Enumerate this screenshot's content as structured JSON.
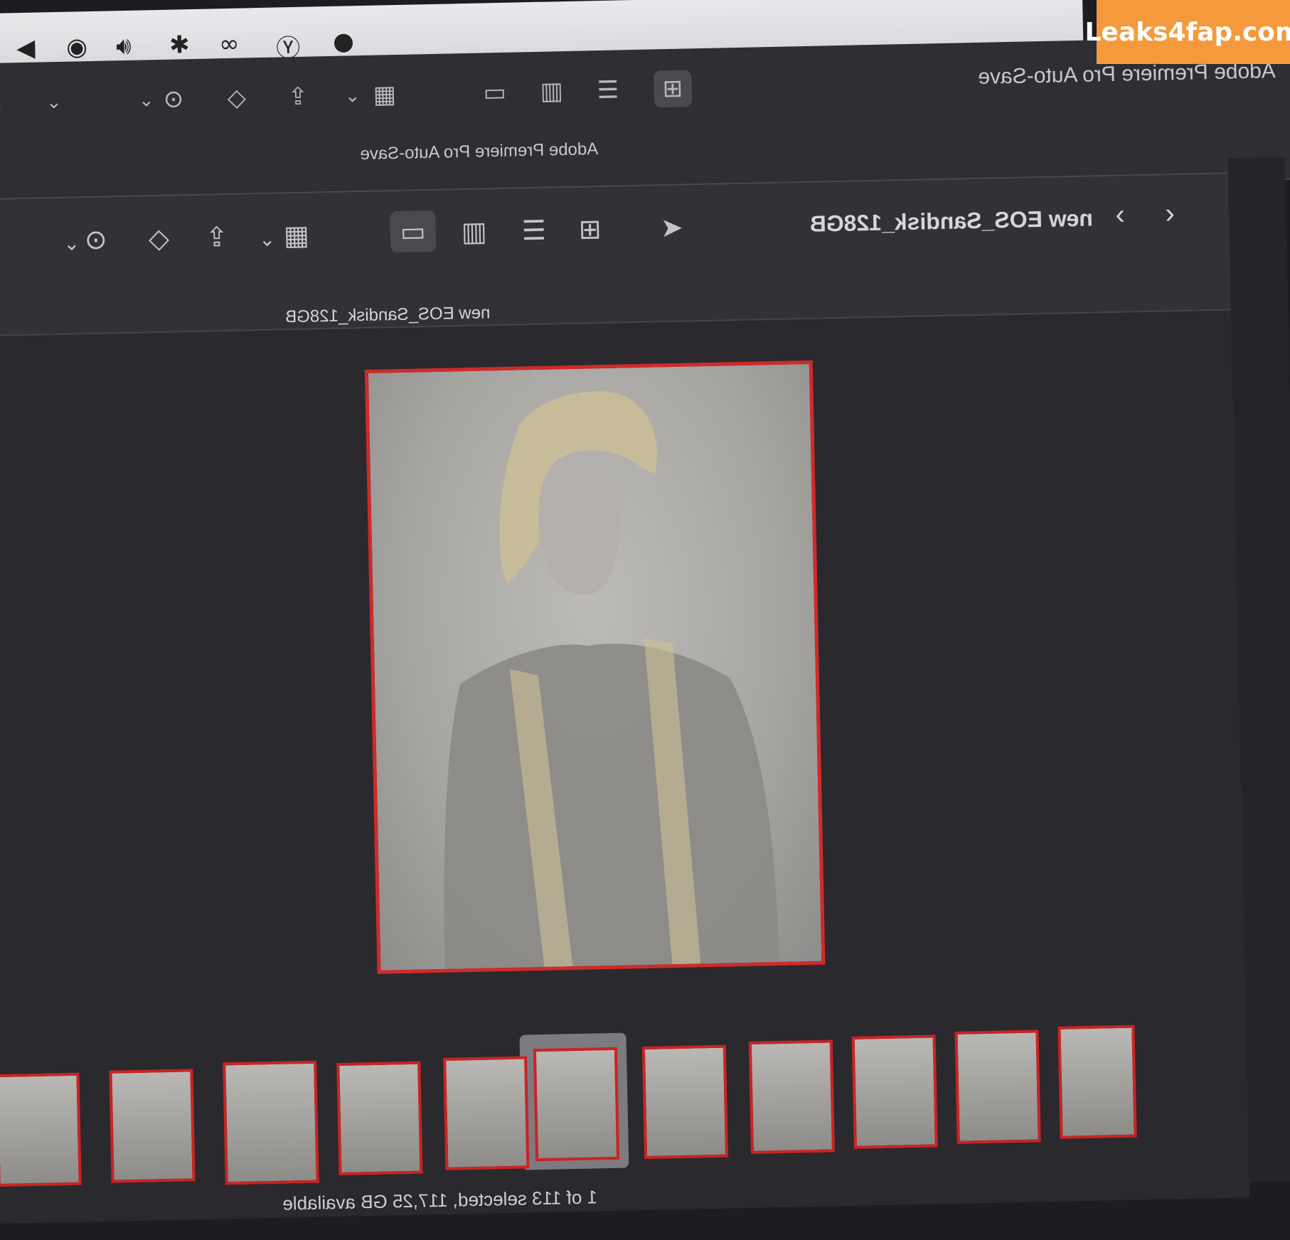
{
  "watermark": "Leaks4fap.com",
  "menubar": {
    "icons": [
      "back-circle-icon",
      "user-circle-icon",
      "volume-icon",
      "bluetooth-icon",
      "creative-cloud-icon",
      "yandex-icon",
      "rocket-icon"
    ]
  },
  "back_window": {
    "title_right": "Adobe Premiere Pro Auto-Save",
    "title_center": "Adobe Premiere Pro Auto-Save"
  },
  "front_window": {
    "title_right": "new EOS_Sandisk_128GB",
    "title_center": "new EOS_Sandisk_128GB",
    "view_modes": [
      "gallery",
      "columns",
      "list",
      "icons"
    ],
    "active_view": "gallery"
  },
  "filmstrip": {
    "count_visible": 11,
    "current_index": 5
  },
  "status": {
    "text": "1 of 113 selected, 117,25 GB available"
  },
  "colors": {
    "selection_border": "#d02a2a",
    "window_bg": "#2a292e",
    "menubar_bg": "#e0e0e4",
    "watermark_bg": "#f59a3c"
  }
}
